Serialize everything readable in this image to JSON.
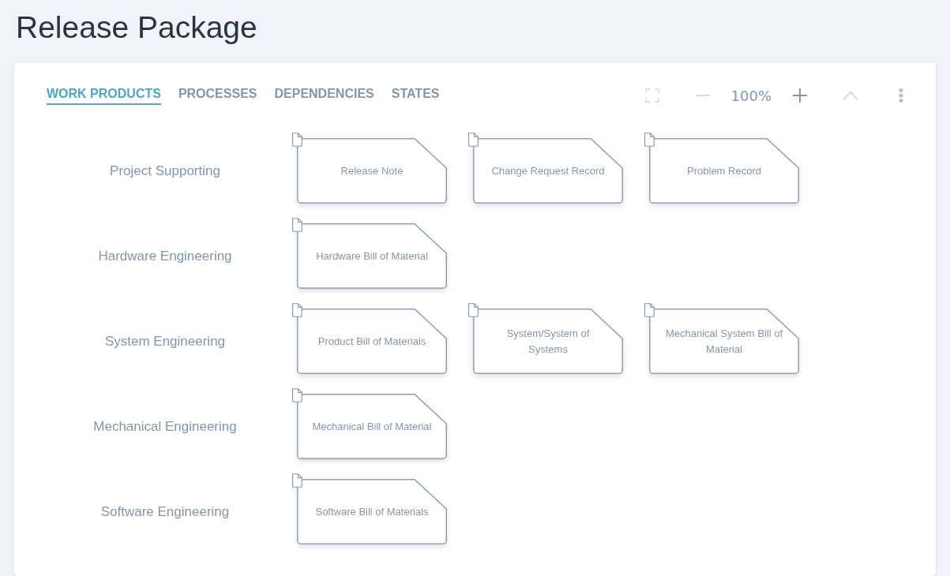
{
  "page": {
    "title": "Release Package"
  },
  "tabs": [
    {
      "label": "WORK PRODUCTS",
      "selected": true
    },
    {
      "label": "PROCESSES",
      "selected": false
    },
    {
      "label": "DEPENDENCIES",
      "selected": false
    },
    {
      "label": "STATES",
      "selected": false
    }
  ],
  "toolbar": [
    {
      "kind": "fullscreen",
      "disabled": true
    },
    {
      "kind": "zoom-out",
      "disabled": true
    },
    {
      "kind": "zoom-level",
      "text": "100%"
    },
    {
      "kind": "zoom-in",
      "disabled": false
    },
    {
      "kind": "collapse",
      "disabled": true
    },
    {
      "kind": "more"
    }
  ],
  "rows": [
    {
      "label": "Project Supporting",
      "work_products": [
        "Release Note",
        "Change Request Record",
        "Problem Record"
      ]
    },
    {
      "label": "Hardware Engineering",
      "work_products": [
        "Hardware Bill of Material"
      ]
    },
    {
      "label": "System Engineering",
      "work_products": [
        "Product Bill of Materials",
        "System/System of Systems",
        "Mechanical System Bill of Material"
      ]
    },
    {
      "label": "Mechanical Engineering",
      "work_products": [
        "Mechanical Bill of Material"
      ]
    },
    {
      "label": "Software Engineering",
      "work_products": [
        "Software Bill of Materials"
      ]
    }
  ]
}
